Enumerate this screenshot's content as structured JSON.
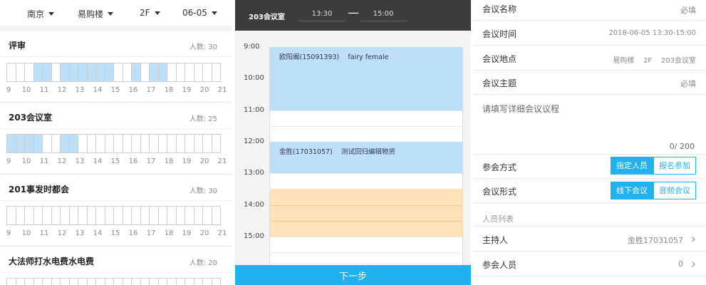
{
  "filters": {
    "city": "南京",
    "building": "易购楼",
    "floor": "2F",
    "date": "06-05"
  },
  "rooms": [
    {
      "name": "评审",
      "capacity": "人数: 30",
      "busy": [
        3,
        4,
        6,
        7,
        8,
        9,
        10,
        11,
        14,
        16,
        17
      ]
    },
    {
      "name": "203会议室",
      "capacity": "人数: 25",
      "busy": [
        0,
        1,
        2,
        3,
        6,
        7
      ]
    },
    {
      "name": "201事发时都会",
      "capacity": "人数: 30",
      "busy": []
    },
    {
      "name": "大法师打水电费水电费",
      "capacity": "人数: 20",
      "busy": []
    }
  ],
  "hour_ticks": [
    "9",
    "10",
    "11",
    "12",
    "13",
    "14",
    "15",
    "16",
    "17",
    "18",
    "19",
    "20",
    "21"
  ],
  "schedule": {
    "room": "203会议室",
    "start": "13:30",
    "end": "15:00",
    "dash": "—",
    "hours": [
      "9:00",
      "10:00",
      "11:00",
      "12:00",
      "13:00",
      "14:00",
      "15:00"
    ],
    "events": [
      {
        "text": "欧阳阖(15091393)    fairy female",
        "start_hour": 9.0,
        "end_hour": 11.0
      },
      {
        "text": "金胜(17031057)    测试回归编辑物资",
        "start_hour": 12.0,
        "end_hour": 13.0
      }
    ],
    "selection": {
      "start_hour": 13.5,
      "end_hour": 15.0
    },
    "next_label": "下一步"
  },
  "form": {
    "name_label": "会议名称",
    "name_value": "必填",
    "time_label": "会议时间",
    "time_value": "2018-06-05 13:30-15:00",
    "place_label": "会议地点",
    "place_value": "易购楼    2F    203会议室",
    "topic_label": "会议主题",
    "topic_value": "必填",
    "detail_placeholder": "请填写详细会议议程",
    "detail_counter": "0/ 200",
    "mode_label": "参会方式",
    "mode_options": [
      "指定人员",
      "报名参加"
    ],
    "type_label": "会议形式",
    "type_options": [
      "线下会议",
      "音频会议"
    ],
    "people_section": "人员列表",
    "host_label": "主持人",
    "host_value": "金胜17031057",
    "attendee_label": "参会人员",
    "attendee_value": "0",
    "chevron": "›"
  },
  "colors": {
    "accent": "#21b1ee",
    "busy": "#bde0f8",
    "selection": "#fde2b8",
    "header": "#3c3c3c"
  }
}
